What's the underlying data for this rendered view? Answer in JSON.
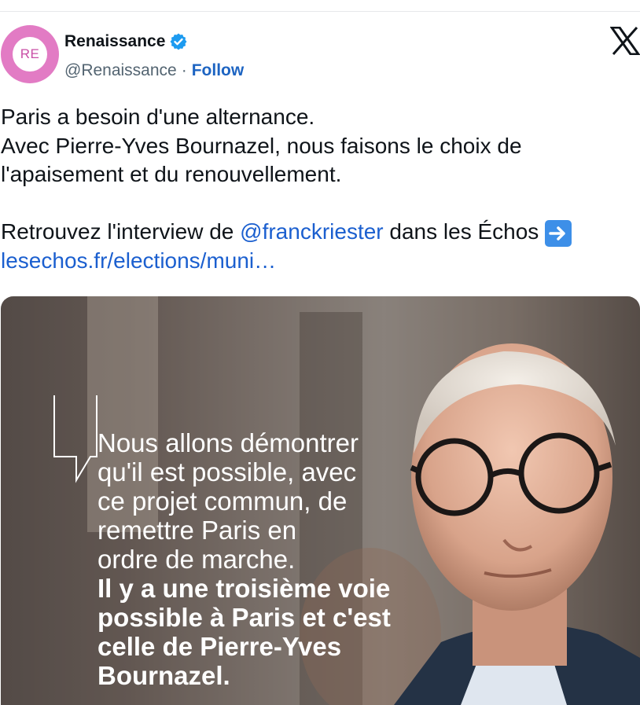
{
  "account": {
    "avatar_text": "RE",
    "display_name": "Renaissance",
    "handle": "@Renaissance",
    "separator": "·",
    "follow_label": "Follow",
    "avatar_color": "#e27bc4",
    "verified_color": "#1d9bf0"
  },
  "tweet": {
    "line1": "Paris a besoin d'une alternance.",
    "line2": "Avec Pierre-Yves Bournazel, nous faisons le choix de",
    "line3": "l'apaisement et du renouvellement.",
    "line4_prefix": "Retrouvez l'interview de ",
    "mention": "@franckriester",
    "line4_suffix": " dans les Échos",
    "link": "lesechos.fr/elections/muni…",
    "arrow_emoji": "➡️"
  },
  "media": {
    "quote_normal": [
      "Nous allons démontrer",
      "qu'il est possible, avec",
      "ce projet commun, de",
      "remettre Paris en",
      "ordre de marche."
    ],
    "quote_bold": [
      "Il y a une troisième voie",
      "possible à Paris et c'est",
      "celle de Pierre-Yves",
      "Bournazel."
    ]
  },
  "icons": {
    "verified": "verified-badge-icon",
    "x_logo": "x-logo-icon",
    "arrow": "right-arrow-emoji-icon",
    "quote": "quote-mark-icon"
  }
}
